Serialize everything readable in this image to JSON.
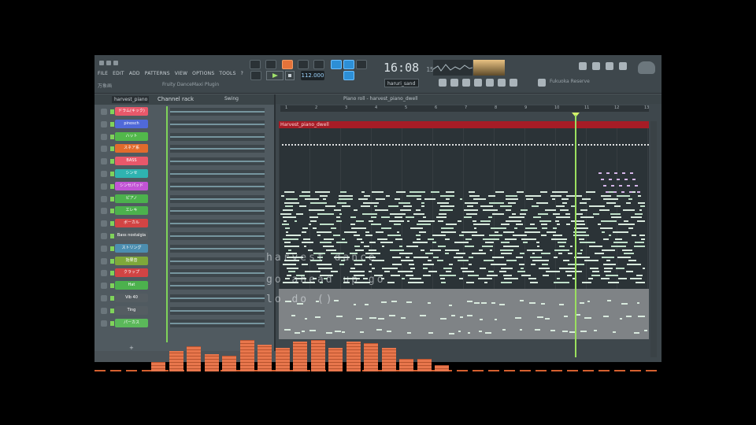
{
  "app": {
    "menu": [
      "FILE",
      "EDIT",
      "ADD",
      "PATTERNS",
      "VIEW",
      "OPTIONS",
      "TOOLS",
      "?"
    ],
    "hint_left": "万象画",
    "hint_plugin": "Fruity DanceMaxi Plugin",
    "tempo": "112.000",
    "time_main": "16:08",
    "time_sub": "15",
    "pattern": "haruri_sand",
    "hint_right": "Fukuoka Reserve"
  },
  "rack": {
    "title": "Channel rack",
    "select": "harvest_piano",
    "swing": "Swing",
    "add_symbol": "+",
    "channels": [
      {
        "name": "ドラム(キック)",
        "color": "#e8586a"
      },
      {
        "name": "pinosch",
        "color": "#5069d8"
      },
      {
        "name": "ハット",
        "color": "#52b84b"
      },
      {
        "name": "スネア系",
        "color": "#e26b2c"
      },
      {
        "name": "BASS",
        "color": "#e8586a"
      },
      {
        "name": "シンセ",
        "color": "#2fb3b0"
      },
      {
        "name": "シンセパッド",
        "color": "#c254d5"
      },
      {
        "name": "ピアノ",
        "color": "#4cb14d"
      },
      {
        "name": "エレキ",
        "color": "#4cb14d"
      },
      {
        "name": "ボーカル",
        "color": "#d24444"
      },
      {
        "name": "Bass nostalgia",
        "color": "#555d62"
      },
      {
        "name": "ストリング",
        "color": "#4c8eb0"
      },
      {
        "name": "効果音",
        "color": "#7fa83a"
      },
      {
        "name": "クラップ",
        "color": "#d24444"
      },
      {
        "name": "Hat",
        "color": "#4cb14d"
      },
      {
        "name": "Vib 40",
        "color": "#555d62"
      },
      {
        "name": "Ting",
        "color": "#555d62"
      },
      {
        "name": "パーカス",
        "color": "#5bb85a"
      }
    ]
  },
  "roll": {
    "title": "Piano roll - harvest_piano_dwell",
    "clip": "Harvest_piano_dwell",
    "ruler": [
      "1",
      "2",
      "3",
      "4",
      "5",
      "6",
      "7",
      "8",
      "9",
      "10",
      "11",
      "12",
      "13"
    ]
  },
  "overlay": {
    "line1": "harvest dance",
    "line2": "go ahead up go",
    "line3": "lo do ()"
  },
  "spectrum": {
    "levels": [
      0.3,
      0.65,
      0.8,
      0.55,
      0.5,
      1.0,
      0.85,
      0.75,
      0.95,
      1.0,
      0.75,
      0.95,
      0.9,
      0.75,
      0.4,
      0.4,
      0.2
    ]
  }
}
